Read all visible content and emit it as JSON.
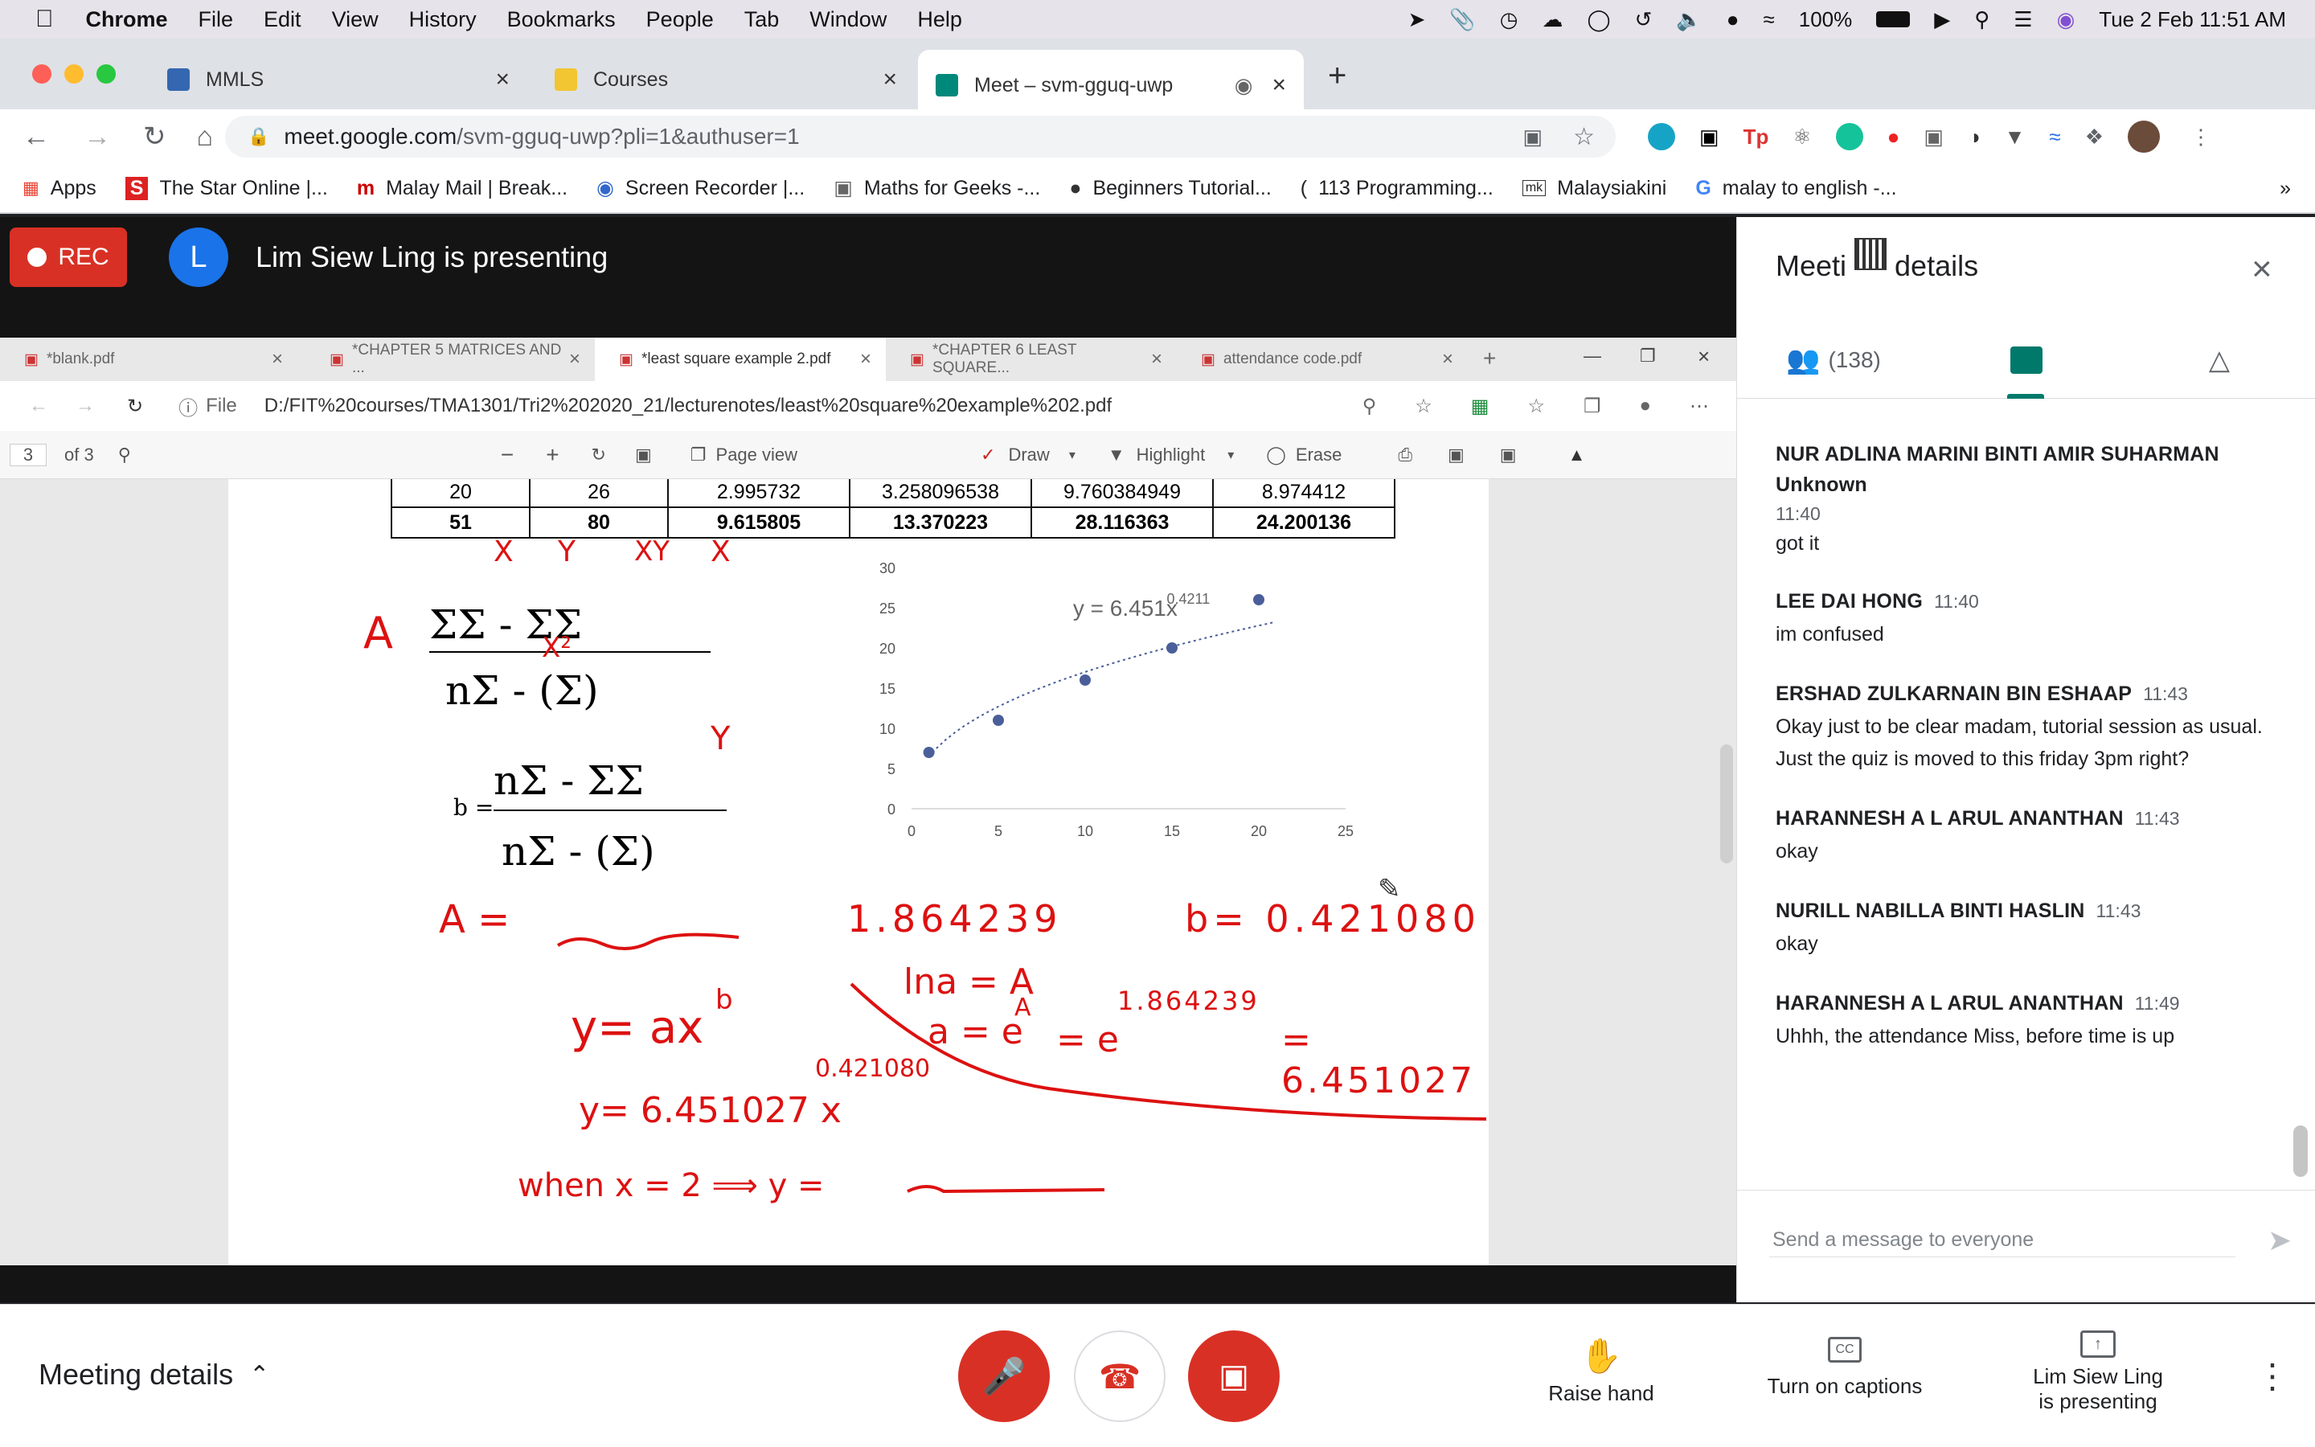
{
  "macos": {
    "app": "Chrome",
    "menu": [
      "File",
      "Edit",
      "View",
      "History",
      "Bookmarks",
      "People",
      "Tab",
      "Window",
      "Help"
    ],
    "battery": "100%",
    "clock": "Tue 2 Feb  11:51 AM"
  },
  "browser": {
    "tabs": [
      {
        "title": "MMLS"
      },
      {
        "title": "Courses"
      },
      {
        "title": "Meet – svm-gguq-uwp"
      }
    ],
    "url_host": "meet.google.com",
    "url_path": "/svm-gguq-uwp?pli=1&authuser=1",
    "bookmarks": [
      "Apps",
      "The Star Online |...",
      "Malay Mail | Break...",
      "Screen Recorder |...",
      "Maths for Geeks -...",
      "Beginners Tutorial...",
      "113 Programming...",
      "Malaysiakini",
      "malay to english -..."
    ]
  },
  "meet": {
    "rec": "REC",
    "presenter_initial": "L",
    "presenting": "Lim Siew Ling is presenting",
    "side_title_a": "Meeti",
    "side_title_b": "details",
    "people_count": "(138)",
    "messages": [
      {
        "sender": "NUR ADLINA MARINI BINTI AMIR SUHARMAN",
        "sub": "Unknown",
        "time": "11:40",
        "text": "got it"
      },
      {
        "sender": "LEE DAI HONG",
        "time": "11:40",
        "text": "im confused"
      },
      {
        "sender": "ERSHAD ZULKARNAIN BIN ESHAAP",
        "time": "11:43",
        "text": "Okay just to be clear madam, tutorial session as usual. Just the quiz is moved to this friday 3pm right?"
      },
      {
        "sender": "HARANNESH A L ARUL ANANTHAN",
        "time": "11:43",
        "text": "okay"
      },
      {
        "sender": "NURILL NABILLA BINTI HASLIN",
        "time": "11:43",
        "text": "okay"
      },
      {
        "sender": "HARANNESH A L ARUL ANANTHAN",
        "time": "11:49",
        "text": "Uhhh, the attendance Miss, before time is up"
      }
    ],
    "chat_placeholder": "Send a message to everyone",
    "bottom": {
      "details": "Meeting details",
      "raise": "Raise hand",
      "captions": "Turn on captions",
      "present_a": "Lim Siew Ling",
      "present_b": "is presenting"
    }
  },
  "shared_pdf": {
    "tabs": [
      "*blank.pdf",
      "*CHAPTER 5 MATRICES AND ...",
      "*least square example 2.pdf",
      "*CHAPTER 6 LEAST SQUARE...",
      "attendance code.pdf"
    ],
    "path": "D:/FIT%20courses/TMA1301/Tri2%202020_21/lecturenotes/least%20square%20example%202.pdf",
    "page": "3",
    "of": "of 3",
    "toolbar": {
      "file": "File",
      "page_view": "Page view",
      "draw": "Draw",
      "highlight": "Highlight",
      "erase": "Erase"
    },
    "table": [
      [
        "20",
        "26",
        "2.995732",
        "3.258096538",
        "9.760384949",
        "8.974412"
      ],
      [
        "51",
        "80",
        "9.615805",
        "13.370223",
        "28.116363",
        "24.200136"
      ]
    ],
    "handwriting": {
      "A_top": "A",
      "A_eq": "A =",
      "A_val": "1.864239",
      "b_val": "b= 0.421080",
      "eq1": "y= ax",
      "exp_b": "b",
      "lna": "lna = A",
      "a_eq": "a = e",
      "expA": "A",
      "eq_e": "= e",
      "exp_e": "1.864239",
      "res": "= 6.451027",
      "exp2": "0.421080",
      "eq2": "y= 6.451027 x",
      "when": "when x = 2  ⟹  y =",
      "X": "X",
      "Y": "Y",
      "XY": "XY",
      "X2": "X²"
    }
  },
  "chart_data": {
    "type": "scatter",
    "trendline": "y = 6.451x^0.4211",
    "trend_main": "y = 6.451x",
    "trend_exp": "0.4211",
    "x": [
      1,
      5,
      10,
      15,
      20
    ],
    "y": [
      7,
      11,
      16,
      20,
      26
    ],
    "xticks": [
      "0",
      "5",
      "10",
      "15",
      "20",
      "25"
    ],
    "yticks": [
      "0",
      "5",
      "10",
      "15",
      "20",
      "25",
      "30"
    ],
    "xlim": [
      0,
      25
    ],
    "ylim": [
      0,
      30
    ],
    "grid": false
  }
}
